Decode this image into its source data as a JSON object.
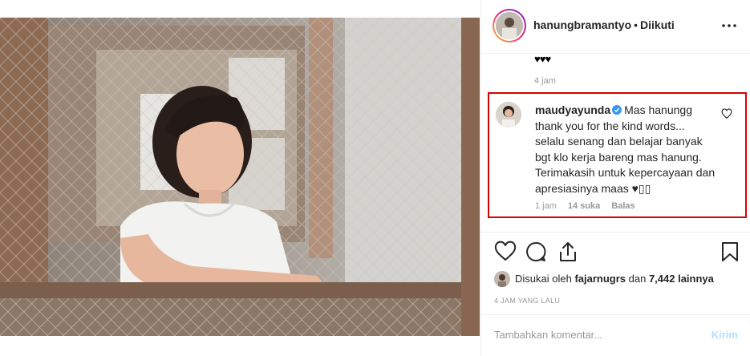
{
  "post": {
    "header": {
      "username": "hanungbramantyo",
      "separator": "•",
      "follow_status": "Diikuti",
      "more_icon": "more-options-icon"
    },
    "caption_tail": {
      "hearts": "♥♥♥",
      "time": "4 jam"
    },
    "highlighted_comment": {
      "username": "maudyayunda",
      "verified": true,
      "text": "Mas hanungg thank you for the kind words... selalu senang dan belajar banyak bgt klo kerja bareng mas hanung. Terimakasih untuk kepercayaan dan apresiasinya maas ♥▯▯",
      "time": "1 jam",
      "likes": "14 suka",
      "reply_label": "Balas",
      "highlight_color": "#d80000"
    },
    "actions": {
      "like_icon": "heart-icon",
      "comment_icon": "comment-icon",
      "share_icon": "share-icon",
      "save_icon": "bookmark-icon"
    },
    "likes": {
      "prefix": "Disukai oleh ",
      "user": "fajarnugrs",
      "middle": " dan ",
      "count": "7,442 lainnya"
    },
    "date": "4 JAM YANG LALU",
    "comment_input": {
      "placeholder": "Tambahkan komentar...",
      "submit_label": "Kirim"
    }
  }
}
